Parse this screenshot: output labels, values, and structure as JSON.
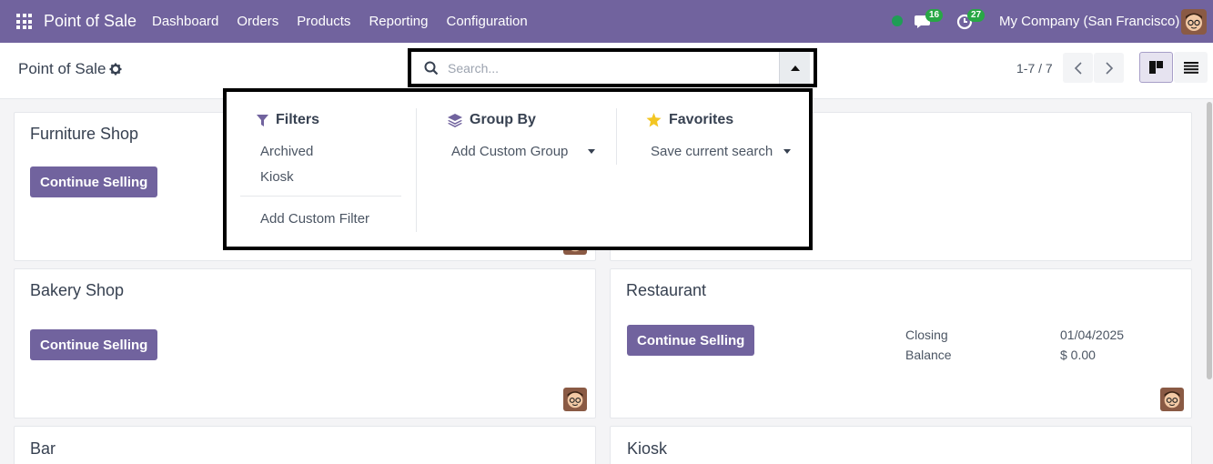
{
  "navbar": {
    "brand": "Point of Sale",
    "menu": [
      "Dashboard",
      "Orders",
      "Products",
      "Reporting",
      "Configuration"
    ],
    "messages_count": "16",
    "activities_count": "27",
    "company": "My Company (San Francisco)"
  },
  "control": {
    "breadcrumb": "Point of Sale",
    "search_placeholder": "Search...",
    "pager": "1-7 / 7"
  },
  "dropdown": {
    "filters": {
      "title": "Filters",
      "items": [
        "Archived",
        "Kiosk"
      ],
      "custom": "Add Custom Filter"
    },
    "group_by": {
      "title": "Group By",
      "custom": "Add Custom Group"
    },
    "favorites": {
      "title": "Favorites",
      "save": "Save current search"
    }
  },
  "cards": [
    {
      "title": "Furniture Shop",
      "button": "Continue Selling"
    },
    {
      "title": "Bakery Shop",
      "button": "Continue Selling"
    },
    {
      "title": "Restaurant",
      "button": "Continue Selling",
      "closing_label": "Closing",
      "closing_value": "01/04/2025",
      "balance_label": "Balance",
      "balance_value": "$ 0.00"
    },
    {
      "title": "Bar"
    },
    {
      "title": "Kiosk"
    }
  ],
  "colors": {
    "brand": "#71639e",
    "online": "#1f9d55",
    "badge": "#28a745"
  }
}
